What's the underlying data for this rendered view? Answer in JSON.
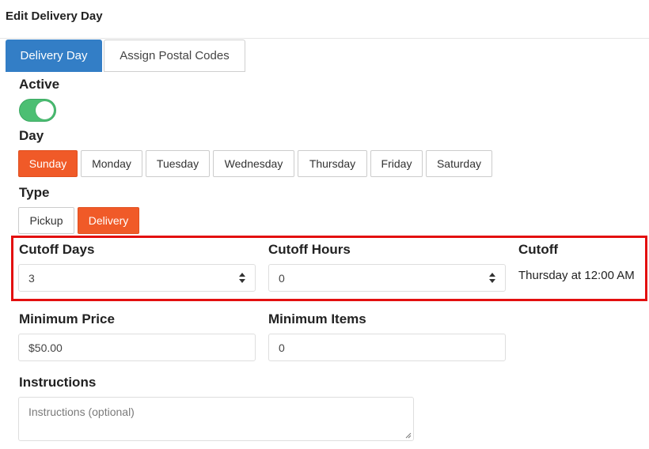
{
  "header": {
    "title": "Edit Delivery Day"
  },
  "tabs": [
    {
      "label": "Delivery Day",
      "active": true
    },
    {
      "label": "Assign Postal Codes",
      "active": false
    }
  ],
  "active": {
    "label": "Active",
    "on": true
  },
  "day": {
    "label": "Day",
    "options": [
      "Sunday",
      "Monday",
      "Tuesday",
      "Wednesday",
      "Thursday",
      "Friday",
      "Saturday"
    ],
    "selected": "Sunday"
  },
  "type": {
    "label": "Type",
    "options": [
      "Pickup",
      "Delivery"
    ],
    "selected": "Delivery"
  },
  "cutoff_days": {
    "label": "Cutoff Days",
    "value": "3"
  },
  "cutoff_hours": {
    "label": "Cutoff Hours",
    "value": "0"
  },
  "cutoff": {
    "label": "Cutoff",
    "value": "Thursday at 12:00 AM"
  },
  "minimum_price": {
    "label": "Minimum Price",
    "value": "$50.00"
  },
  "minimum_items": {
    "label": "Minimum Items",
    "value": "0"
  },
  "instructions": {
    "label": "Instructions",
    "placeholder": "Instructions (optional)"
  },
  "colors": {
    "primary": "#337ec6",
    "accent": "#f05a28",
    "toggle_on": "#4cbf73",
    "highlight": "#e30f0f"
  }
}
